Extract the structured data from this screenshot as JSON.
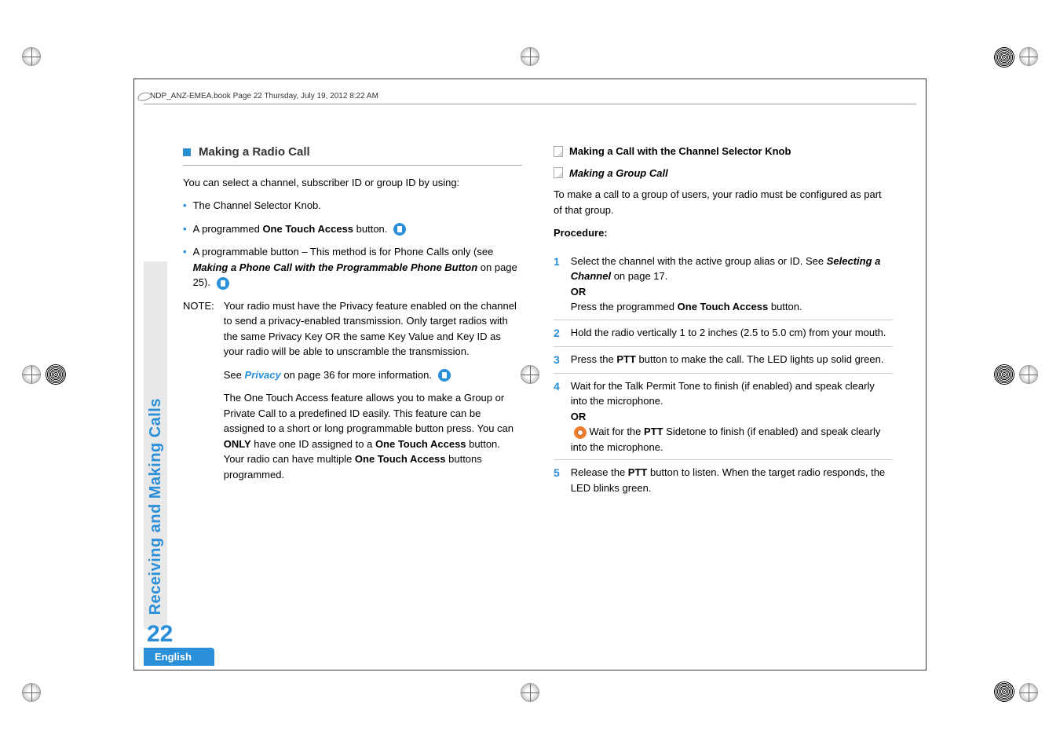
{
  "header": "NDP_ANZ-EMEA.book  Page 22  Thursday, July 19, 2012  8:22 AM",
  "sidebar": {
    "title": "Receiving and Making Calls",
    "page": "22",
    "lang": "English"
  },
  "left": {
    "heading": "Making a Radio Call",
    "intro": "You can select a channel, subscriber ID or group ID by using:",
    "bullets": [
      {
        "text": "The Channel Selector Knob."
      },
      {
        "prefix": "A programmed ",
        "bold": "One Touch Access",
        "suffix": " button."
      },
      {
        "prefix": "A programmable button – This method is for Phone Calls only (see ",
        "boldItalic": "Making a Phone Call with the Programmable Phone Button",
        "suffix": " on page 25)."
      }
    ],
    "note_label": "NOTE:",
    "note_p1": "Your radio must have the Privacy feature enabled on the channel to send a privacy-enabled transmission. Only target radios with the same Privacy Key OR the same Key Value and Key ID as your radio will be able to unscramble the transmission.",
    "note_p2_pre": "See ",
    "note_p2_link": "Privacy",
    "note_p2_suf": " on page 36 for more information.",
    "note_p3_a": "The One Touch Access feature allows you to make a Group or Private Call to a predefined ID easily. This feature can be assigned to a short or long programmable button press. You can ",
    "note_p3_only": "ONLY",
    "note_p3_b": " have one ID assigned to a ",
    "note_p3_ota1": "One Touch Access",
    "note_p3_c": " button. Your radio can have multiple ",
    "note_p3_ota2": "One Touch Access",
    "note_p3_d": " buttons programmed."
  },
  "right": {
    "h1": "Making a Call with the Channel Selector Knob",
    "h2": "Making a Group Call",
    "intro": "To make a call to a group of users, your radio must be configured as part of that group.",
    "proc": "Procedure:",
    "steps": {
      "s1_a": "Select the channel with the active group alias or ID. See ",
      "s1_link": "Selecting a Channel",
      "s1_b": " on page 17.",
      "s1_or": "OR",
      "s1_c": "Press the programmed ",
      "s1_ota": "One Touch Access",
      "s1_d": " button.",
      "s2": "Hold the radio vertically 1 to 2 inches (2.5 to 5.0 cm) from your mouth.",
      "s3_a": "Press the ",
      "s3_ptt": "PTT",
      "s3_b": " button to make the call. The LED lights up solid green.",
      "s4_a": "Wait for the Talk Permit Tone to finish (if enabled) and speak clearly into the microphone.",
      "s4_or": "OR",
      "s4_b": "  Wait for the ",
      "s4_ptt": "PTT",
      "s4_c": " Sidetone to finish (if enabled) and speak clearly into the microphone.",
      "s5_a": "Release the ",
      "s5_ptt": "PTT",
      "s5_b": " button to listen. When the target radio responds, the LED blinks green."
    }
  }
}
